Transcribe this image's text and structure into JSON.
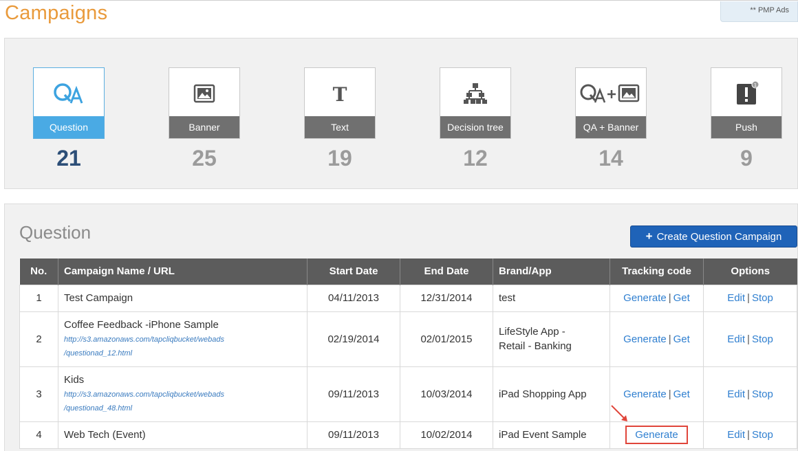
{
  "page": {
    "title": "Campaigns",
    "badge": "** PMP Ads"
  },
  "categories": [
    {
      "label": "Question",
      "count": "21",
      "icon": "qa-icon",
      "active": true
    },
    {
      "label": "Banner",
      "count": "25",
      "icon": "image-icon",
      "active": false
    },
    {
      "label": "Text",
      "count": "19",
      "icon": "text-icon",
      "active": false
    },
    {
      "label": "Decision tree",
      "count": "12",
      "icon": "decision-tree-icon",
      "active": false
    },
    {
      "label": "QA + Banner",
      "count": "14",
      "icon": "qa-banner-icon",
      "active": false
    },
    {
      "label": "Push",
      "count": "9",
      "icon": "push-icon",
      "active": false
    }
  ],
  "section": {
    "title": "Question",
    "create_button": "Create Question Campaign"
  },
  "table": {
    "headers": [
      "No.",
      "Campaign Name / URL",
      "Start Date",
      "End Date",
      "Brand/App",
      "Tracking code",
      "Options"
    ],
    "rows": [
      {
        "no": "1",
        "name": "Test Campaign",
        "url_line1": "",
        "url_line2": "",
        "start": "04/11/2013",
        "end": "12/31/2014",
        "brand_line1": "test",
        "brand_line2": "",
        "generate": "Generate",
        "get": "Get",
        "edit": "Edit",
        "stop": "Stop"
      },
      {
        "no": "2",
        "name": "Coffee Feedback -iPhone Sample",
        "url_line1": "http://s3.amazonaws.com/tapcliqbucket/webads",
        "url_line2": "/questionad_12.html",
        "start": "02/19/2014",
        "end": "02/01/2015",
        "brand_line1": "LifeStyle App -",
        "brand_line2": "Retail - Banking",
        "generate": "Generate",
        "get": "Get",
        "edit": "Edit",
        "stop": "Stop"
      },
      {
        "no": "3",
        "name": "Kids",
        "url_line1": "http://s3.amazonaws.com/tapcliqbucket/webads",
        "url_line2": "/questionad_48.html",
        "start": "09/11/2013",
        "end": "10/03/2014",
        "brand_line1": "iPad Shopping App",
        "brand_line2": "",
        "generate": "Generate",
        "get": "Get",
        "edit": "Edit",
        "stop": "Stop"
      },
      {
        "no": "4",
        "name": "Web Tech (Event)",
        "url_line1": "",
        "url_line2": "",
        "start": "09/11/2013",
        "end": "10/02/2014",
        "brand_line1": "iPad Event Sample",
        "brand_line2": "",
        "generate": "Generate",
        "get": "",
        "edit": "Edit",
        "stop": "Stop"
      }
    ],
    "separator": "|"
  },
  "colors": {
    "title_orange": "#e99a3b",
    "active_blue": "#4aaae4",
    "button_blue": "#1f63b8",
    "header_gray": "#5c5c5c",
    "link_blue": "#2f7fd0",
    "highlight_red": "#e0453a"
  }
}
